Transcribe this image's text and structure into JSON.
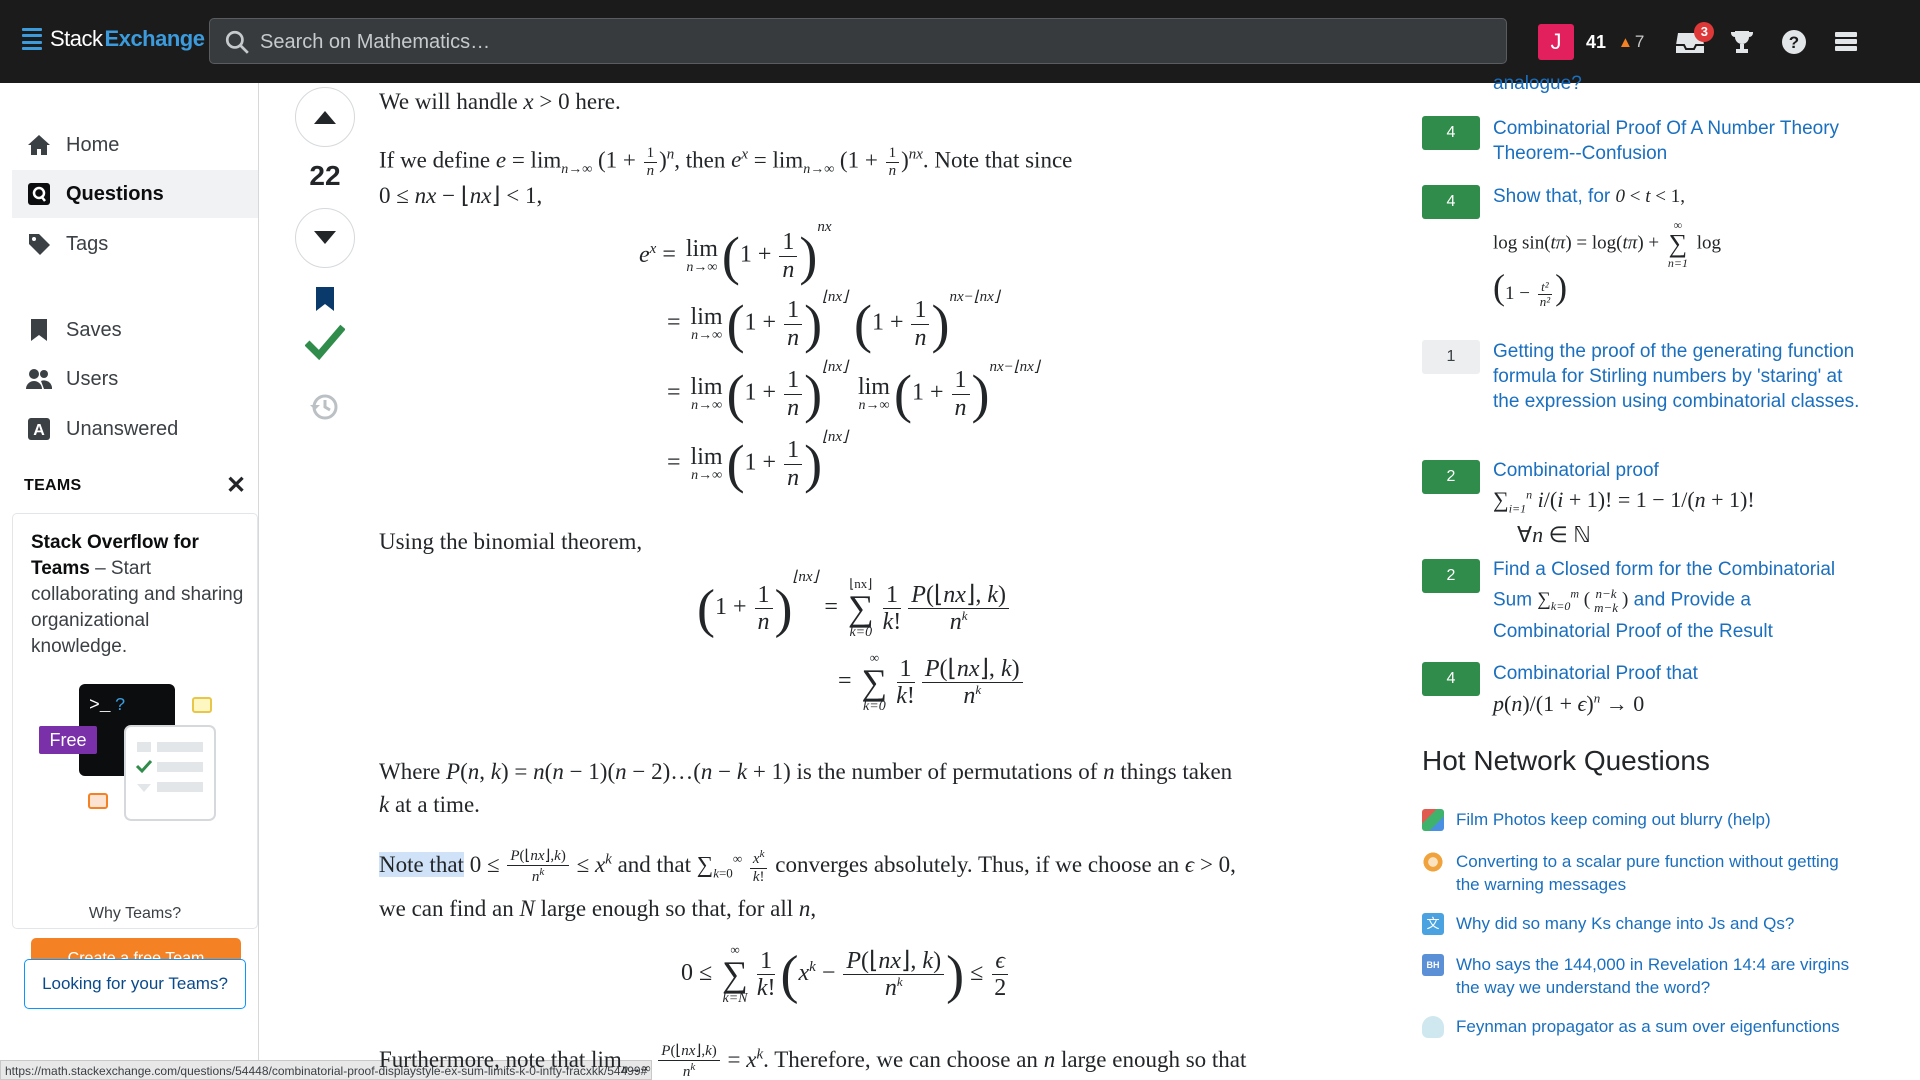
{
  "header": {
    "brand_stack": "Stack",
    "brand_exchange": "Exchange",
    "search_placeholder": "Search on Mathematics…",
    "avatar_letter": "J",
    "reputation": "41",
    "bronze_count": "7",
    "inbox_count": "3"
  },
  "sidebar": {
    "items": [
      {
        "label": "Home"
      },
      {
        "label": "Questions"
      },
      {
        "label": "Tags"
      },
      {
        "label": "Saves"
      },
      {
        "label": "Users"
      },
      {
        "label": "Unanswered"
      }
    ],
    "teams_heading": "TEAMS",
    "teams_title": "Stack Overflow for Teams",
    "teams_desc": " – Start collaborating and sharing organizational knowledge.",
    "free_badge": "Free",
    "create_team": "Create a free Team",
    "why_teams": "Why Teams?",
    "looking_teams": "Looking for your Teams?"
  },
  "status_url": "https://math.stackexchange.com/questions/54448/combinatorial-proof-displaystyle-ex-sum-limits-k-0-infty-fracxkk/54499#",
  "answer": {
    "score": "22",
    "p1": "We will handle",
    "p2_a": "If we define",
    "p2_b": ", then",
    "p2_c": ". Note that since",
    "p3": "Using the binomial theorem,",
    "p4_a": "Where",
    "p4_b": "is the number of permutations of",
    "p4_c": "things taken",
    "p4_d": "at a time.",
    "p5_a": "Note that",
    "p5_b": "and that",
    "p5_c": "converges absolutely. Thus, if we choose an",
    "p6_a": "we can find an",
    "p6_b": "large enough so that, for all",
    "p7_a": "Furthermore, note that lim",
    "p7_b": ". Therefore, we can choose an",
    "p7_c": "large enough so that"
  },
  "linked": [
    {
      "score": "",
      "title": "analogue?"
    },
    {
      "score": "4",
      "title": "Combinatorial Proof Of A Number Theory Theorem--Confusion"
    },
    {
      "score": "4",
      "title": "Show that, for"
    },
    {
      "score": "1",
      "title": "Getting the proof of the generating function formula for Stirling numbers by 'staring' at the expression using combinatorial classes."
    },
    {
      "score": "2",
      "title": "Combinatorial proof"
    },
    {
      "score": "2",
      "title": "Find a Closed form for the Combinatorial Sum",
      "title_b": "and Provide a Combinatorial Proof of the Result"
    },
    {
      "score": "4",
      "title": "Combinatorial Proof that"
    }
  ],
  "hot_network": {
    "title": "Hot Network Questions",
    "items": [
      {
        "title": "Film Photos keep coming out blurry (help)",
        "icon": "photo-site-icon",
        "color": "#e05a4f"
      },
      {
        "title": "Converting to a scalar pure function without getting the warning messages",
        "icon": "mathematica-site-icon",
        "color": "#f0a23c"
      },
      {
        "title": "Why did so many Ks change into Js and Qs?",
        "icon": "linguistics-site-icon",
        "color": "#4aa3e0"
      },
      {
        "title": "Who says the 144,000 in Revelation 14:4 are virgins the way we understand the word?",
        "icon": "hermeneutics-site-icon",
        "color": "#5b8fd6"
      },
      {
        "title": "Feynman propagator as a sum over eigenfunctions",
        "icon": "physics-site-icon",
        "color": "#9fd3e6"
      }
    ]
  },
  "colors": {
    "accent_orange": "#f48225",
    "link_blue": "#1a6fbf",
    "accepted_green": "#2f8c4a"
  }
}
